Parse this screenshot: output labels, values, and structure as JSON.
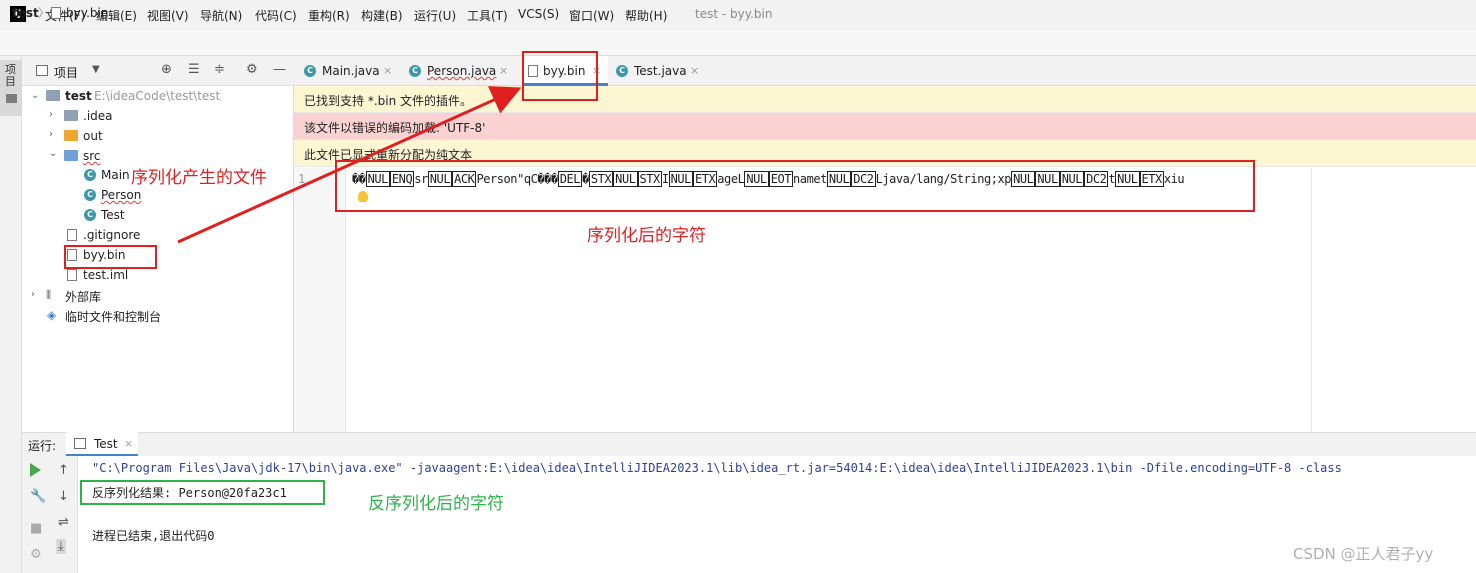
{
  "menubar": {
    "logo_text": "IJ",
    "items": [
      "文件(F)",
      "编辑(E)",
      "视图(V)",
      "导航(N)",
      "代码(C)",
      "重构(R)",
      "构建(B)",
      "运行(U)",
      "工具(T)",
      "VCS(S)",
      "窗口(W)",
      "帮助(H)"
    ],
    "window_title": "test - byy.bin"
  },
  "breadcrumb": {
    "project": "test",
    "separator": "〉",
    "file": "byy.bin"
  },
  "left_stripe": {
    "project_tab_label": "项目"
  },
  "project_panel": {
    "header_label": "项目",
    "tree": {
      "root_name": "test",
      "root_path": "E:\\ideaCode\\test\\test",
      "idea": ".idea",
      "out": "out",
      "src": "src",
      "class_main": "Main",
      "class_person": "Person",
      "class_test": "Test",
      "gitignore": ".gitignore",
      "byy_bin": "byy.bin",
      "test_iml": "test.iml",
      "external_libs": "外部库",
      "scratches": "临时文件和控制台"
    }
  },
  "editor_tabs": {
    "main": "Main.java",
    "person": "Person.java",
    "byy": "byy.bin",
    "test": "Test.java",
    "close_glyph": "×"
  },
  "notices": {
    "plugin": "已找到支持 *.bin 文件的插件。",
    "encoding": "该文件以错误的编码加载: 'UTF-8'",
    "plain_text": "此文件已显式重新分配为纯文本"
  },
  "editor": {
    "line_number": "1",
    "code_parts": {
      "p1": "��",
      "p2": "NUL",
      "p3": "ENQ",
      "p4": "sr",
      "p5": "NUL",
      "p6": "ACK",
      "p7": "Person\"qC���",
      "p8": "DEL",
      "p9": "�",
      "p10": "STX",
      "p11": "NUL",
      "p12": "STX",
      "p13": "I",
      "p14": "NUL",
      "p15": "ETX",
      "p16": "age",
      "p17": "L",
      "p18": "NUL",
      "p19": "EOT",
      "p20": "name",
      "p21": "t",
      "p22": "NUL",
      "p23": "DC2",
      "p24": "Ljava/lang/String;xp",
      "p25": "NUL",
      "p26": "NUL",
      "p27": "NUL",
      "p28": "DC2",
      "p29": "t",
      "p30": "NUL",
      "p31": "ETX",
      "p32": "xiu"
    }
  },
  "run_panel": {
    "label": "运行:",
    "tab_label": "Test",
    "tab_close": "×",
    "command_line": "\"C:\\Program Files\\Java\\jdk-17\\bin\\java.exe\" -javaagent:E:\\idea\\idea\\IntelliJIDEA2023.1\\lib\\idea_rt.jar=54014:E:\\idea\\idea\\IntelliJIDEA2023.1\\bin -Dfile.encoding=UTF-8 -class",
    "result_line": "反序列化结果: Person@20fa23c1",
    "exit_line": "进程已结束,退出代码0"
  },
  "annotations": {
    "serial_file": "序列化产生的文件",
    "serial_chars": "序列化后的字符",
    "deserial_chars": "反序列化后的字符",
    "red_color": "#e02020",
    "green_color": "#2db34a"
  },
  "watermark": "CSDN @正人君子yy"
}
